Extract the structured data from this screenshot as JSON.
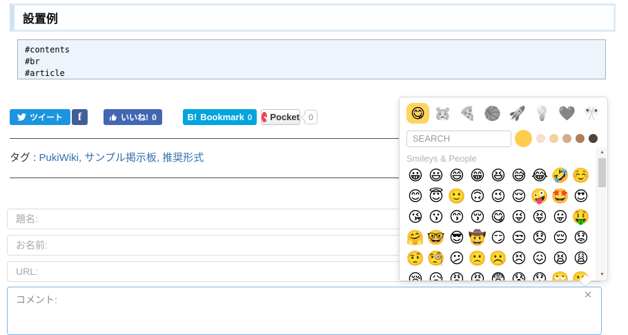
{
  "page": {
    "title": "設置例",
    "code": "#contents\n#br\n#article",
    "social": {
      "tweet": "ツイート",
      "facebook": "f",
      "like": "いいね!",
      "like_count": "0",
      "hatena_b": "B!",
      "hatena": "Bookmark",
      "hatena_count": "0",
      "pocket": "Pocket",
      "pocket_count": "0"
    },
    "tags": {
      "label": "タグ :",
      "items": [
        "PukiWiki",
        "サンプル掲示板",
        "推奨形式"
      ]
    },
    "form": {
      "subject_placeholder": "題名:",
      "name_placeholder": "お名前:",
      "url_placeholder": "URL:",
      "comment_placeholder": "コメント:"
    }
  },
  "emoji_picker": {
    "category_icons": [
      "😋",
      "🐹",
      "🍕",
      "🏀",
      "🚀",
      "💡",
      "❤️",
      "🎌"
    ],
    "search_placeholder": "SEARCH",
    "skin_tones": [
      "#FFCC4D",
      "#F7DECE",
      "#F3D2A2",
      "#D5AB88",
      "#AF7E57",
      "#51413A"
    ],
    "section_label": "Smileys & People",
    "emojis": [
      "😀",
      "😃",
      "😄",
      "😁",
      "😆",
      "😅",
      "😂",
      "🤣",
      "☺️",
      "😊",
      "😇",
      "🙂",
      "🙃",
      "😉",
      "😌",
      "🤪",
      "🤩",
      "😍",
      "😘",
      "😗",
      "😙",
      "😚",
      "😋",
      "😜",
      "😝",
      "😛",
      "🤑",
      "🤗",
      "🤓",
      "😎",
      "🤠",
      "😏",
      "😒",
      "😞",
      "😔",
      "😟",
      "🤨",
      "🧐",
      "😕",
      "🙁",
      "☹️",
      "😣",
      "😖",
      "😫",
      "😩",
      "😪",
      "😥",
      "😡",
      "😠",
      "😨",
      "😰",
      "😯",
      "🙄",
      "😬"
    ],
    "close_icon": "✕",
    "scroll_up_icon": "▲",
    "scroll_down_icon": "▼"
  },
  "colors": {
    "twitter": "#1b95e0",
    "facebook": "#415e9b",
    "like": "#4267b2",
    "hatena": "#00a4de",
    "pocket_red": "#ef4056",
    "link": "#2f6fad",
    "active_tab_bg": "#ffd45e"
  }
}
